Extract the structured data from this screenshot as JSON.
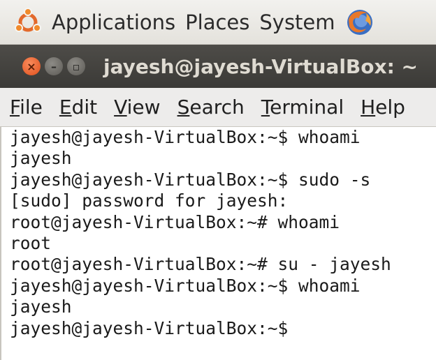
{
  "panel": {
    "items": [
      "Applications",
      "Places",
      "System"
    ],
    "icons": [
      "ubuntu-logo-icon",
      "firefox-icon"
    ]
  },
  "window": {
    "title": "jayesh@jayesh-VirtualBox: ~",
    "buttons": [
      "close",
      "minimize",
      "maximize"
    ],
    "colors": {
      "close": "#e85a25",
      "titlebar": "#3f3e3a"
    }
  },
  "menubar": {
    "items": [
      {
        "accel": "F",
        "rest": "ile"
      },
      {
        "accel": "E",
        "rest": "dit"
      },
      {
        "accel": "V",
        "rest": "iew"
      },
      {
        "accel": "S",
        "rest": "earch"
      },
      {
        "accel": "T",
        "rest": "erminal"
      },
      {
        "accel": "H",
        "rest": "elp"
      }
    ]
  },
  "terminal": {
    "lines": [
      "jayesh@jayesh-VirtualBox:~$ whoami",
      "jayesh",
      "jayesh@jayesh-VirtualBox:~$ sudo -s",
      "[sudo] password for jayesh:",
      "root@jayesh-VirtualBox:~# whoami",
      "root",
      "root@jayesh-VirtualBox:~# su - jayesh",
      "jayesh@jayesh-VirtualBox:~$ whoami",
      "jayesh",
      "jayesh@jayesh-VirtualBox:~$"
    ]
  }
}
